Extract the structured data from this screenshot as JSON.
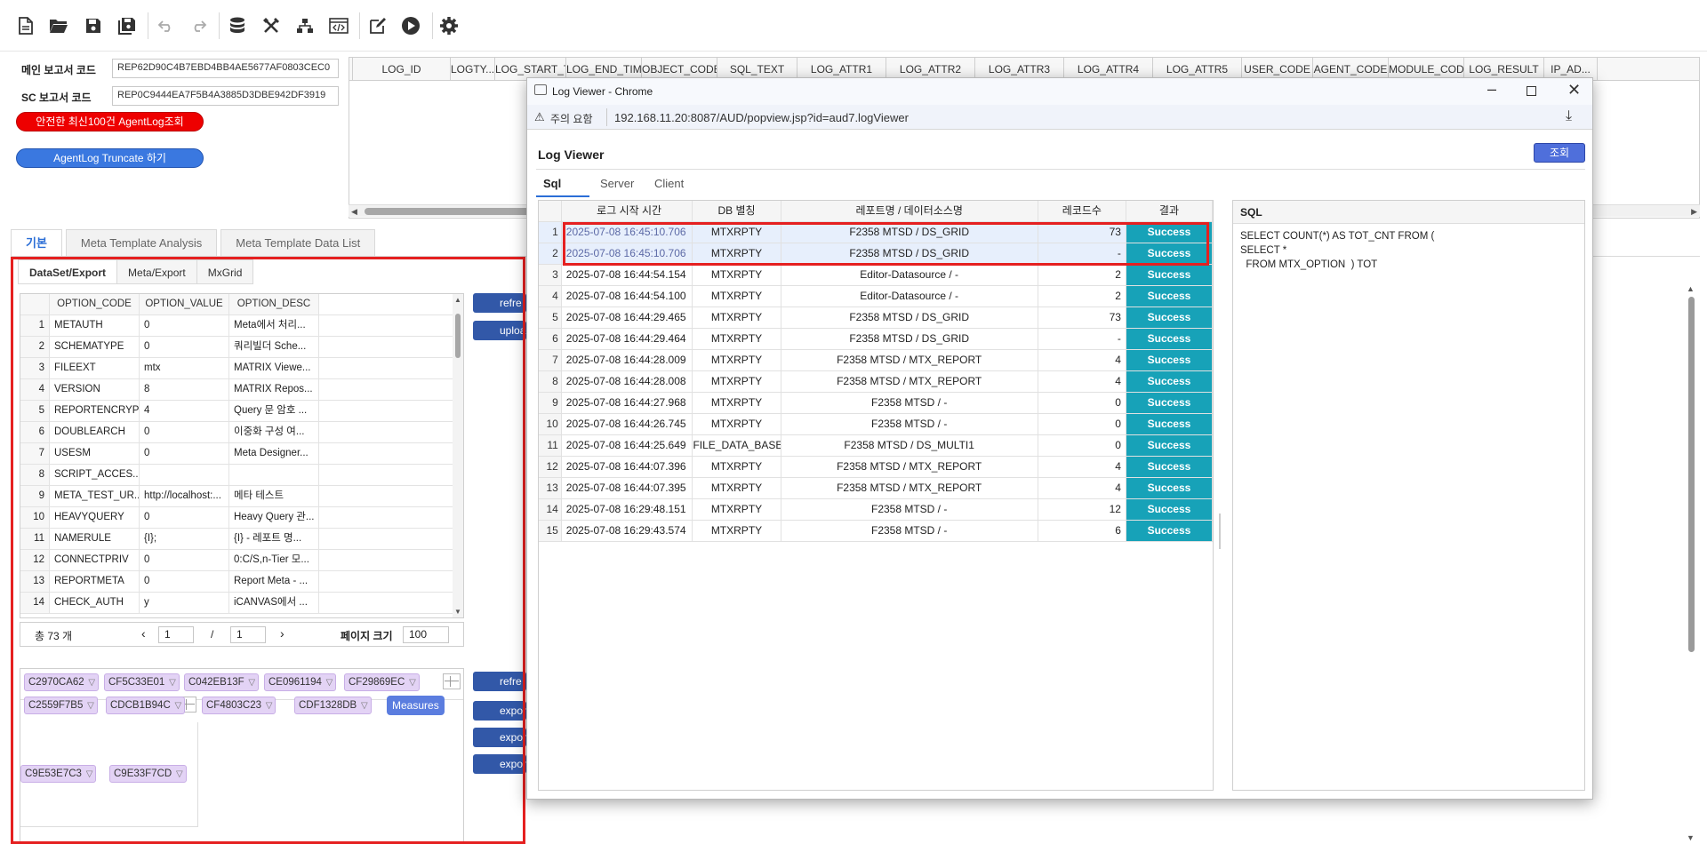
{
  "toolbar": {
    "icons": [
      "new-file-icon",
      "open-folder-icon",
      "save-icon",
      "save-all-icon",
      "undo-icon",
      "redo-icon",
      "database-icon",
      "tools-icon",
      "hierarchy-icon",
      "code-icon",
      "edit-icon",
      "run-icon",
      "settings-icon"
    ]
  },
  "report": {
    "main_label": "메인 보고서 코드",
    "main_code": "REP62D90C4B7EBD4BB4AE5677AF0803CEC0",
    "sc_label": "SC 보고서 코드",
    "sc_code": "REP0C9444EA7F5B4A3885D3DBE942DF3919",
    "btn_recent": "안전한 최신100건 AgentLog조회",
    "btn_truncate": "AgentLog Truncate 하기"
  },
  "log_grid": {
    "columns": [
      "LOG_ID",
      "LOGTY...",
      "LOG_START_TIME",
      "LOG_END_TIME",
      "OBJECT_CODE",
      "SQL_TEXT",
      "LOG_ATTR1",
      "LOG_ATTR2",
      "LOG_ATTR3",
      "LOG_ATTR4",
      "LOG_ATTR5",
      "USER_CODE",
      "AGENT_CODE",
      "MODULE_CODE",
      "LOG_RESULT",
      "IP_AD..."
    ]
  },
  "main_tabs": [
    "기본",
    "Meta Template Analysis",
    "Meta Template Data List"
  ],
  "sub_tabs": [
    "DataSet/Export",
    "Meta/Export",
    "MxGrid"
  ],
  "option_grid": {
    "columns": [
      "OPTION_CODE",
      "OPTION_VALUE",
      "OPTION_DESC"
    ],
    "rows": [
      [
        "1",
        "METAUTH",
        "0",
        "Meta에서 처리..."
      ],
      [
        "2",
        "SCHEMATYPE",
        "0",
        "쿼리빌더 Sche..."
      ],
      [
        "3",
        "FILEEXT",
        "mtx",
        "MATRIX Viewe..."
      ],
      [
        "4",
        "VERSION",
        "8",
        "MATRIX Repos..."
      ],
      [
        "5",
        "REPORTENCRYP...",
        "4",
        "Query 문 암호 ..."
      ],
      [
        "6",
        "DOUBLEARCH",
        "0",
        "이중화 구성 여..."
      ],
      [
        "7",
        "USESM",
        "0",
        "Meta Designer..."
      ],
      [
        "8",
        "SCRIPT_ACCES...",
        "",
        ""
      ],
      [
        "9",
        "META_TEST_UR...",
        "http://localhost:...",
        "메타 테스트"
      ],
      [
        "10",
        "HEAVYQUERY",
        "0",
        "Heavy Query 관..."
      ],
      [
        "11",
        "NAMERULE",
        "{I};",
        "{I} - 레포트 명..."
      ],
      [
        "12",
        "CONNECTPRIV",
        "0",
        "0:C/S,n-Tier 모..."
      ],
      [
        "13",
        "REPORTMETA",
        "0",
        "Report Meta - ..."
      ],
      [
        "14",
        "CHECK_AUTH",
        "y",
        "iCANVAS에서 ..."
      ]
    ]
  },
  "pager": {
    "total": "총  73 개",
    "page": "1",
    "slash": "/",
    "pages": "1",
    "size_label": "페이지 크기",
    "size": "100"
  },
  "side_buttons": [
    "refre",
    "upload",
    "refre",
    "export",
    "export",
    "exportE"
  ],
  "pivot": {
    "row1": [
      "C2970CA62",
      "CF5C33E01",
      "C042EB13F",
      "CE0961194",
      "CF29869EC"
    ],
    "row2": [
      "C2559F7B5",
      "CDCB1B94C"
    ],
    "row2b": [
      "CF4803C23",
      "CDF1328DB"
    ],
    "measures": "Measures",
    "row3": [
      "C9E53E7C3",
      "C9E33F7CD"
    ]
  },
  "popup": {
    "window_title": "Log Viewer - Chrome",
    "security_label": "주의 요함",
    "url": "192.168.11.20:8087/AUD/popview.jsp?id=aud7.logViewer",
    "heading": "Log Viewer",
    "query_button": "조회",
    "tabs": [
      "Sql",
      "Server",
      "Client"
    ],
    "columns": [
      "로그 시작 시간",
      "DB 별칭",
      "레포트명 / 데이터소스명",
      "레코드수",
      "결과"
    ],
    "rows": [
      [
        "1",
        "2025-07-08 16:45:10.706",
        "MTXRPTY",
        "F2358 MTSD / DS_GRID",
        "73",
        "Success"
      ],
      [
        "2",
        "2025-07-08 16:45:10.706",
        "MTXRPTY",
        "F2358 MTSD / DS_GRID",
        "-",
        "Success"
      ],
      [
        "3",
        "2025-07-08 16:44:54.154",
        "MTXRPTY",
        "Editor-Datasource /  -",
        "2",
        "Success"
      ],
      [
        "4",
        "2025-07-08 16:44:54.100",
        "MTXRPTY",
        "Editor-Datasource /  -",
        "2",
        "Success"
      ],
      [
        "5",
        "2025-07-08 16:44:29.465",
        "MTXRPTY",
        "F2358 MTSD / DS_GRID",
        "73",
        "Success"
      ],
      [
        "6",
        "2025-07-08 16:44:29.464",
        "MTXRPTY",
        "F2358 MTSD / DS_GRID",
        "-",
        "Success"
      ],
      [
        "7",
        "2025-07-08 16:44:28.009",
        "MTXRPTY",
        "F2358 MTSD / MTX_REPORT",
        "4",
        "Success"
      ],
      [
        "8",
        "2025-07-08 16:44:28.008",
        "MTXRPTY",
        "F2358 MTSD / MTX_REPORT",
        "4",
        "Success"
      ],
      [
        "9",
        "2025-07-08 16:44:27.968",
        "MTXRPTY",
        "F2358 MTSD /  -",
        "0",
        "Success"
      ],
      [
        "10",
        "2025-07-08 16:44:26.745",
        "MTXRPTY",
        "F2358 MTSD /  -",
        "0",
        "Success"
      ],
      [
        "11",
        "2025-07-08 16:44:25.649",
        "FILE_DATA_BASE",
        "F2358 MTSD / DS_MULTI1",
        "0",
        "Success"
      ],
      [
        "12",
        "2025-07-08 16:44:07.396",
        "MTXRPTY",
        "F2358 MTSD / MTX_REPORT",
        "4",
        "Success"
      ],
      [
        "13",
        "2025-07-08 16:44:07.395",
        "MTXRPTY",
        "F2358 MTSD / MTX_REPORT",
        "4",
        "Success"
      ],
      [
        "14",
        "2025-07-08 16:29:48.151",
        "MTXRPTY",
        "F2358 MTSD /  -",
        "12",
        "Success"
      ],
      [
        "15",
        "2025-07-08 16:29:43.574",
        "MTXRPTY",
        "F2358 MTSD /  -",
        "6",
        "Success"
      ]
    ],
    "sql_title": "SQL",
    "sql_lines": [
      "SELECT COUNT(*) AS TOT_CNT FROM (",
      "SELECT *",
      "  FROM MTX_OPTION  ) TOT"
    ]
  },
  "colors": {
    "accent": "#2b6ed6",
    "success": "#17a2b8",
    "highlight_border": "#e52020",
    "chip": "#e3d3f5",
    "measures": "#5b7ddf"
  }
}
